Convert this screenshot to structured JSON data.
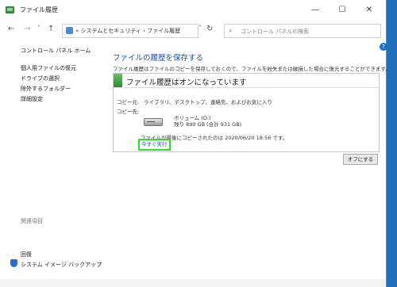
{
  "window": {
    "title": "ファイル履歴",
    "minimize": "—",
    "maximize": "☐",
    "close": "✕"
  },
  "nav": {
    "back": "←",
    "forward": "→",
    "recent": "˅",
    "up": "↑",
    "breadcrumb": "« システムとセキュリティ › ファイル履歴",
    "dropdown": "˅",
    "refresh": "↻",
    "search_placeholder": "コントロール パネルの検索",
    "search_icon": "⌕"
  },
  "sidebar": {
    "home": "コントロール パネル ホーム",
    "items": [
      {
        "label": "個人用ファイルの復元"
      },
      {
        "label": "ドライブの選択"
      },
      {
        "label": "除外するフォルダー"
      },
      {
        "label": "詳細設定"
      }
    ],
    "related_heading": "関連項目",
    "related": [
      {
        "label": "回復"
      },
      {
        "label": "システム イメージ バックアップ"
      }
    ]
  },
  "main": {
    "title": "ファイルの履歴を保存する",
    "description": "ファイル履歴はファイルのコピーを保存しておくので、ファイルを紛失または破損した場合に復元することができます。",
    "status": "ファイル履歴はオンになっています",
    "copy_from_label": "コピー元:",
    "copy_from_value": "ライブラリ、デスクトップ、連絡先、およびお気に入り",
    "copy_to_label": "コピー先:",
    "drive_name": "ボリューム (D:)",
    "drive_space": "残り 890 GB (合計 931 GB)",
    "last_copy": "ファイルが最後にコピーされたのは 2020/06/20 18:56 です。",
    "run_now": "今すぐ実行",
    "turn_off": "オフにする"
  },
  "help_icon": "?"
}
